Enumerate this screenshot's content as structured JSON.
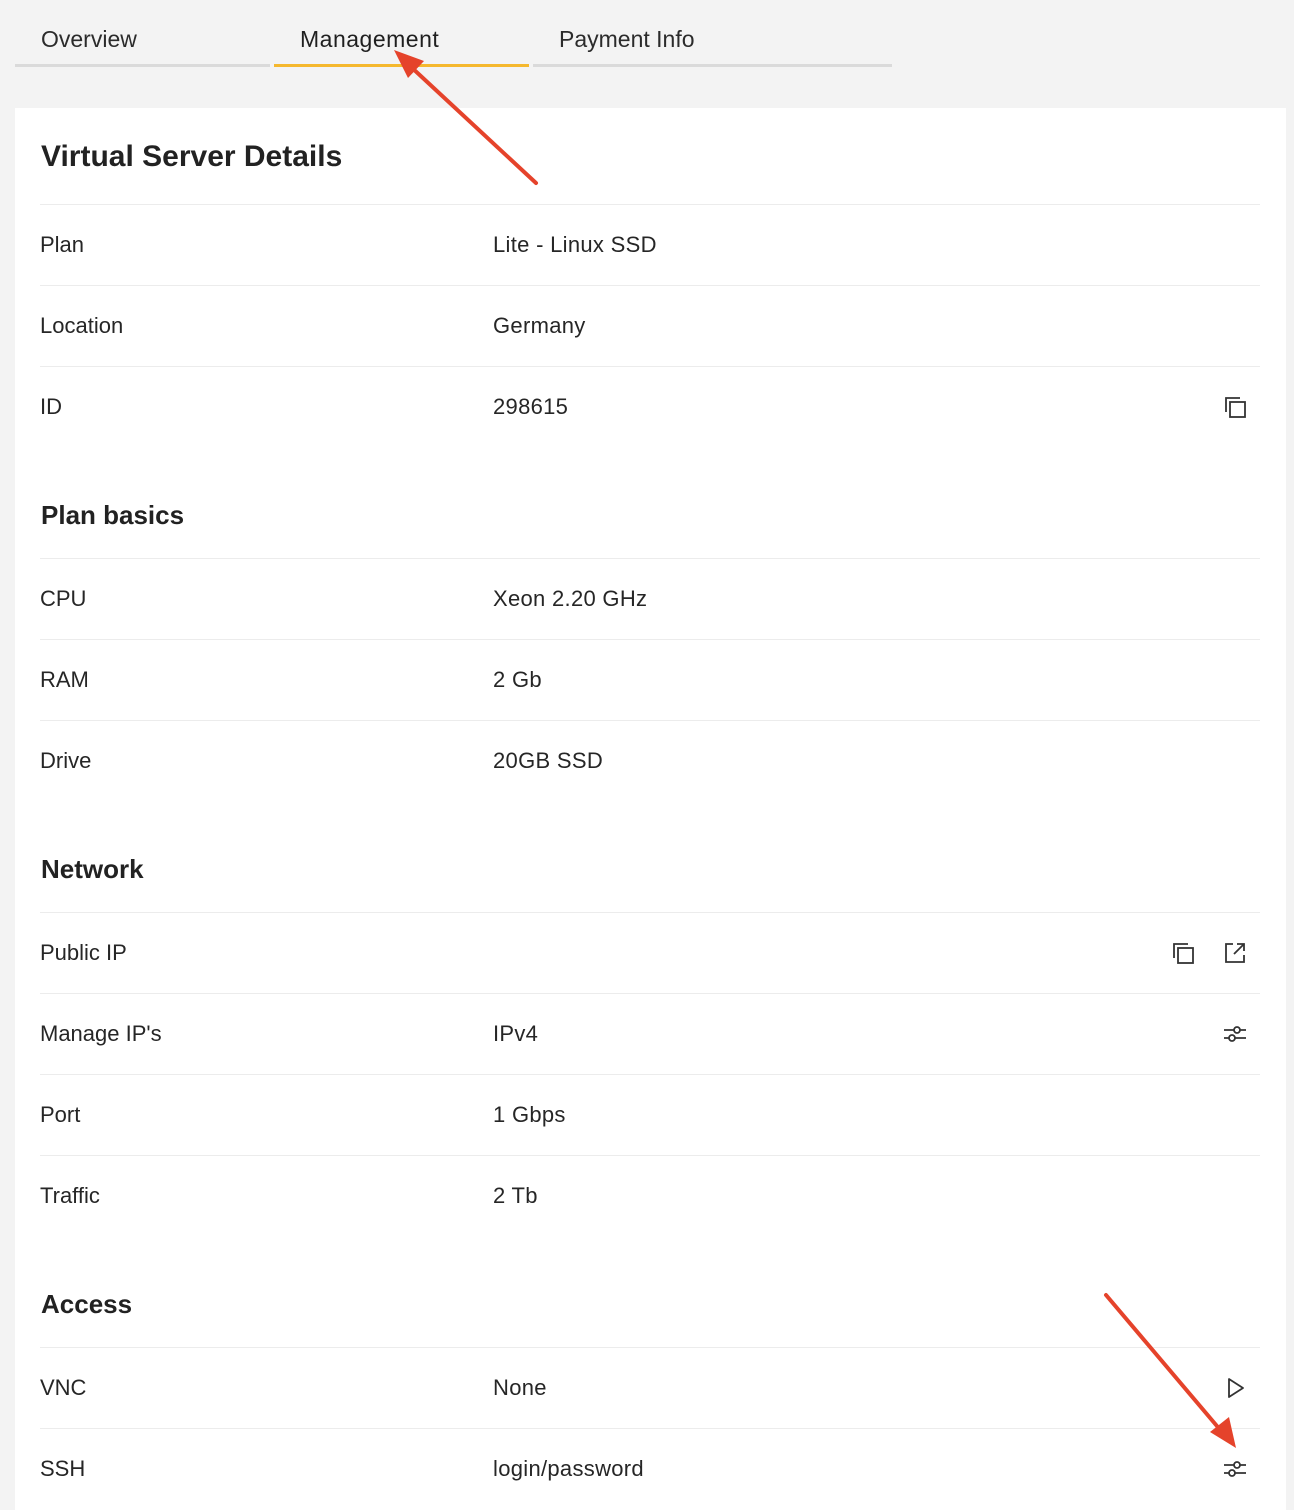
{
  "tabs": {
    "overview": "Overview",
    "management": "Management",
    "payment": "Payment Info",
    "active": "Management"
  },
  "details": {
    "title": "Virtual Server Details",
    "plan_label": "Plan",
    "plan_value": "Lite - Linux SSD",
    "location_label": "Location",
    "location_value": "Germany",
    "id_label": "ID",
    "id_value": "298615"
  },
  "plan_basics": {
    "title": "Plan basics",
    "cpu_label": "CPU",
    "cpu_value": "Xeon 2.20 GHz",
    "ram_label": "RAM",
    "ram_value": "2 Gb",
    "drive_label": "Drive",
    "drive_value": "20GB SSD"
  },
  "network": {
    "title": "Network",
    "public_ip_label": "Public IP",
    "public_ip_value": "",
    "manage_ips_label": "Manage IP's",
    "manage_ips_value": "IPv4",
    "port_label": "Port",
    "port_value": "1 Gbps",
    "traffic_label": "Traffic",
    "traffic_value": "2 Tb"
  },
  "access": {
    "title": "Access",
    "vnc_label": "VNC",
    "vnc_value": "None",
    "ssh_label": "SSH",
    "ssh_value": "login/password"
  },
  "icons": {
    "id_copy": "copy-icon",
    "public_ip_copy": "copy-icon",
    "public_ip_open": "external-link-icon",
    "manage_ips_settings": "sliders-icon",
    "vnc_launch": "play-icon",
    "ssh_settings": "sliders-icon",
    "annotation_arrows": "red-arrow-icon"
  },
  "colors": {
    "accent": "#f5b82e",
    "annotation": "#e5432b",
    "background": "#f3f3f3",
    "card": "#ffffff"
  }
}
